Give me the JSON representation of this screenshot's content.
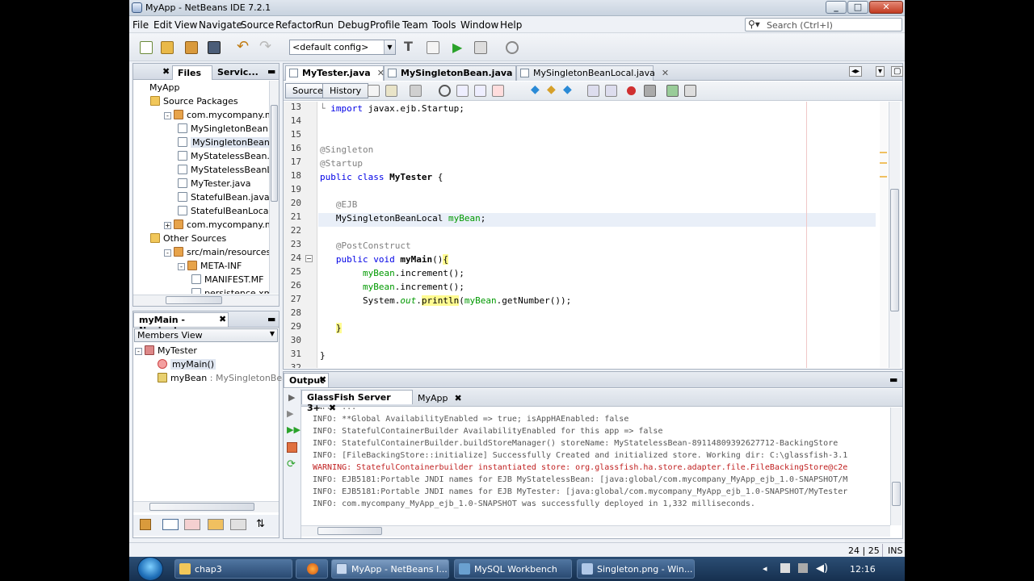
{
  "window": {
    "title": "MyApp - NetBeans IDE 7.2.1",
    "controls": [
      "_",
      "□",
      "✕"
    ]
  },
  "menu": [
    "File",
    "Edit",
    "View",
    "Navigate",
    "Source",
    "Refactor",
    "Run",
    "Debug",
    "Profile",
    "Team",
    "Tools",
    "Window",
    "Help"
  ],
  "search": {
    "placeholder": "Search (Ctrl+I)"
  },
  "toolbar": {
    "config": "<default config>"
  },
  "projects_pane": {
    "tabs": [
      "Files",
      "Servic..."
    ],
    "tree": [
      {
        "label": "MyApp",
        "level": 0,
        "icon": "proj"
      },
      {
        "label": "Source Packages",
        "level": 1,
        "icon": "fold"
      },
      {
        "label": "com.mycompany.myapp.be",
        "level": 2,
        "icon": "pkg",
        "exp": "-"
      },
      {
        "label": "MySingletonBean.java",
        "level": 3,
        "icon": "java"
      },
      {
        "label": "MySingletonBeanLocal.",
        "level": 3,
        "icon": "java",
        "selected": true
      },
      {
        "label": "MyStatelessBean.java",
        "level": 3,
        "icon": "java"
      },
      {
        "label": "MyStatelessBeanLocal.",
        "level": 3,
        "icon": "java"
      },
      {
        "label": "MyTester.java",
        "level": 3,
        "icon": "java"
      },
      {
        "label": "StatefulBean.java",
        "level": 3,
        "icon": "java"
      },
      {
        "label": "StatefulBeanLocal.java",
        "level": 3,
        "icon": "java"
      },
      {
        "label": "com.mycompany.myapp.er",
        "level": 2,
        "icon": "pkg",
        "exp": "+"
      },
      {
        "label": "Other Sources",
        "level": 1,
        "icon": "fold"
      },
      {
        "label": "src/main/resources",
        "level": 2,
        "icon": "pkg",
        "exp": "-"
      },
      {
        "label": "META-INF",
        "level": 3,
        "icon": "pkg",
        "exp": "-"
      },
      {
        "label": "MANIFEST.MF",
        "level": 4,
        "icon": "java"
      },
      {
        "label": "persistence.xml",
        "level": 4,
        "icon": "java"
      }
    ]
  },
  "navigator": {
    "title": "myMain - Navigator",
    "view": "Members View",
    "items": [
      {
        "label": "MyTester",
        "level": 0
      },
      {
        "label": "myMain()",
        "level": 1,
        "selected": true
      },
      {
        "label": "myBean",
        "suffix": " : MySingletonBeanLo",
        "level": 1
      }
    ]
  },
  "editor": {
    "tabs": [
      {
        "label": "MyTester.java",
        "active": true
      },
      {
        "label": "MySingletonBean.java",
        "active": false
      },
      {
        "label": "MySingletonBeanLocal.java",
        "active": false
      }
    ],
    "source_label": "Source",
    "history_label": "History",
    "line_numbers": [
      "13",
      "14",
      "15",
      "16",
      "17",
      "18",
      "19",
      "20",
      "21",
      "22",
      "23",
      "24",
      "25",
      "26",
      "27",
      "28",
      "29",
      "30",
      "31",
      "32"
    ]
  },
  "output": {
    "title": "Output",
    "tabs": [
      "GlassFish Server 3+",
      "MyApp"
    ],
    "lines": [
      {
        "text": "INFO: **Global AvailabilityEnabled => true; isAppHAEnabled: false",
        "warn": false
      },
      {
        "text": "INFO: StatefulContainerBuilder AvailabilityEnabled for this app => false",
        "warn": false
      },
      {
        "text": "INFO: StatefulContainerBuilder.buildStoreManager() storeName: MyStatelessBean-89114809392627712-BackingStore",
        "warn": false
      },
      {
        "text": "INFO: [FileBackingStore::initialize] Successfully Created and initialized store. Working dir: C:\\glassfish-3.1",
        "warn": false
      },
      {
        "text": "WARNING: StatefulContainerbuilder instantiated store: org.glassfish.ha.store.adapter.file.FileBackingStore@c2e",
        "warn": true
      },
      {
        "text": "INFO: EJB5181:Portable JNDI names for EJB MyStatelessBean: [java:global/com.mycompany_MyApp_ejb_1.0-SNAPSHOT/M",
        "warn": false
      },
      {
        "text": "INFO: EJB5181:Portable JNDI names for EJB MyTester: [java:global/com.mycompany_MyApp_ejb_1.0-SNAPSHOT/MyTester",
        "warn": false
      },
      {
        "text": "INFO: com.mycompany_MyApp_ejb_1.0-SNAPSHOT was successfully deployed in 1,332 milliseconds.",
        "warn": false
      }
    ]
  },
  "status": {
    "position": "24 | 25",
    "mode": "INS"
  },
  "taskbar": {
    "items": [
      {
        "label": "chap3",
        "active": false
      },
      {
        "label": "MyApp - NetBeans I...",
        "active": true
      },
      {
        "label": "MySQL Workbench",
        "active": false
      },
      {
        "label": "Singleton.png - Win...",
        "active": false
      }
    ],
    "clock": "12:16"
  },
  "colors": {
    "keyword": "#0000e6",
    "field": "#009900",
    "annotation": "#808080",
    "warning": "#c02020"
  }
}
